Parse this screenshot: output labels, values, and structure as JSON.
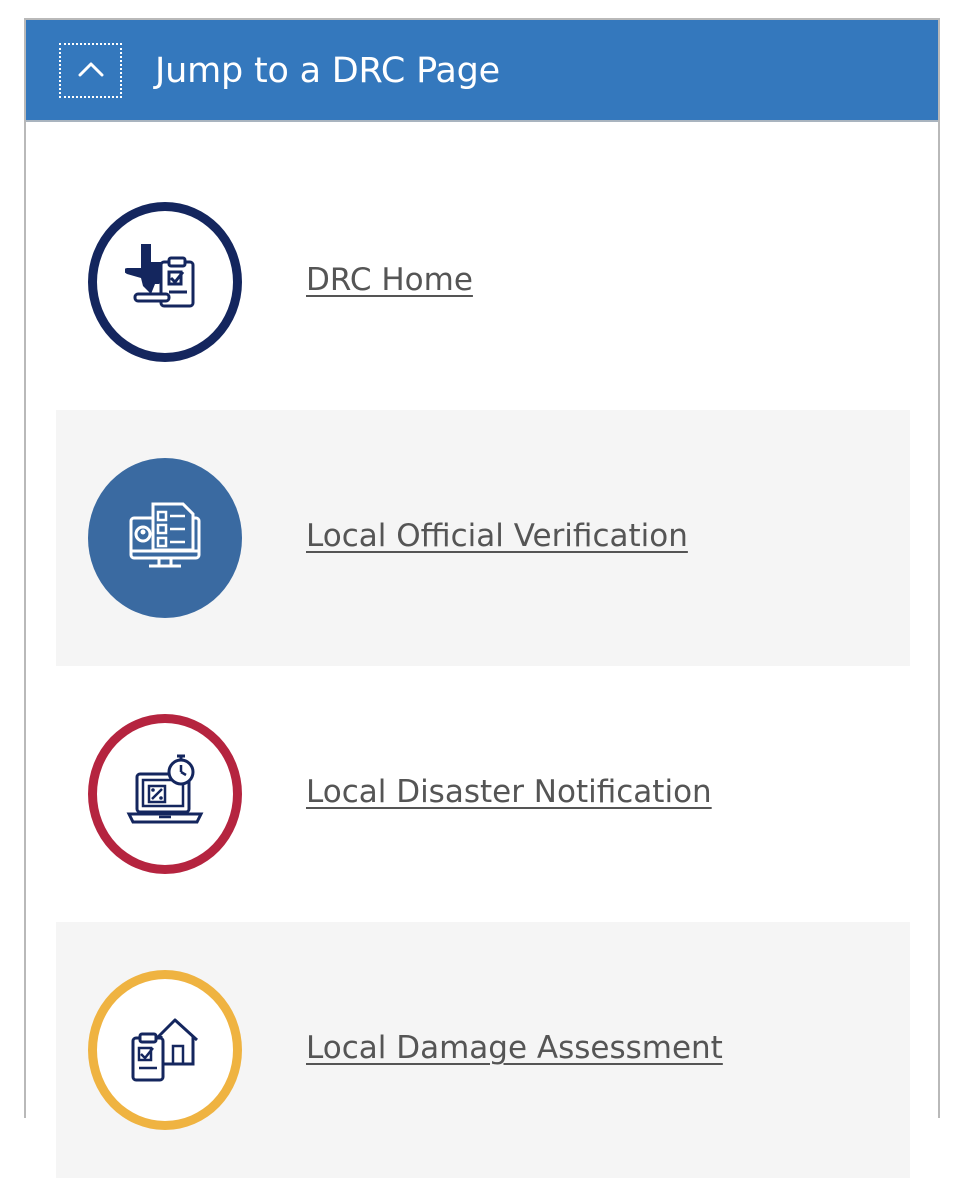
{
  "header": {
    "title": "Jump to a DRC Page",
    "toggle_icon": "chevron-up-icon",
    "background_color": "#3478bd"
  },
  "items": [
    {
      "label": "DRC Home",
      "icon": "texas-clipboard-icon",
      "accent_color": "#14265e",
      "style": "ring"
    },
    {
      "label": "Local Official Verification",
      "icon": "monitor-checklist-icon",
      "accent_color": "#3a6aa1",
      "style": "filled"
    },
    {
      "label": "Local Disaster Notification",
      "icon": "laptop-stopwatch-icon",
      "accent_color": "#b5243f",
      "style": "ring"
    },
    {
      "label": "Local Damage Assessment",
      "icon": "house-clipboard-icon",
      "accent_color": "#efb341",
      "style": "ring"
    }
  ]
}
